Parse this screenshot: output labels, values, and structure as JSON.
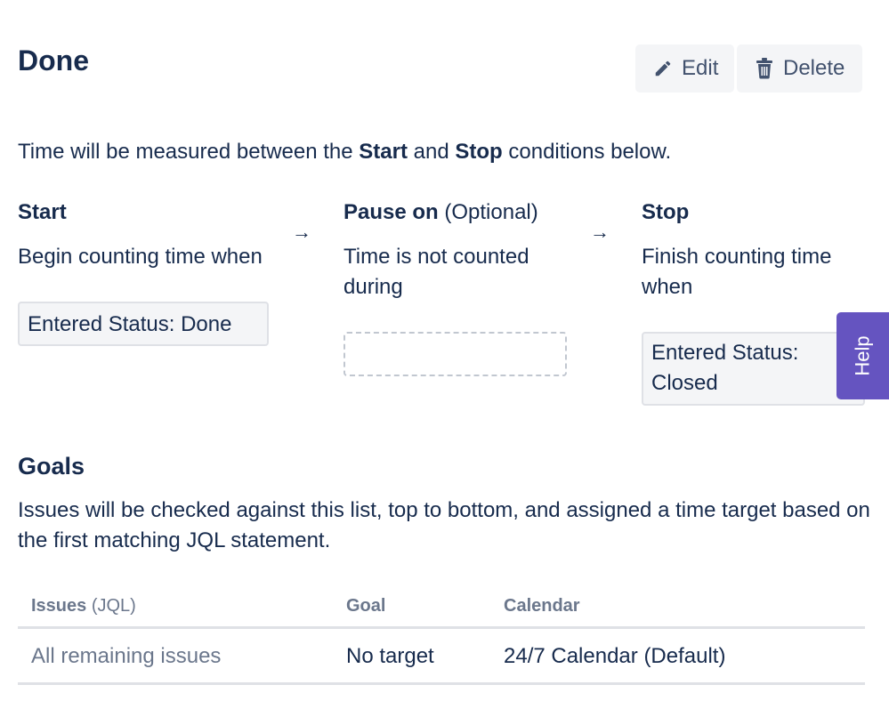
{
  "page": {
    "title": "Done"
  },
  "toolbar": {
    "edit_label": "Edit",
    "delete_label": "Delete",
    "edit_icon": "pencil-icon",
    "delete_icon": "trash-icon"
  },
  "intro": {
    "prefix": "Time will be measured between the ",
    "start_word": "Start",
    "middle": " and ",
    "stop_word": "Stop",
    "suffix": " conditions below."
  },
  "conditions": {
    "start": {
      "heading": "Start",
      "description": "Begin counting time when",
      "value": "Entered Status: Done"
    },
    "pause": {
      "heading": "Pause on",
      "optional": " (Optional)",
      "description": "Time is not counted during"
    },
    "stop": {
      "heading": "Stop",
      "description": "Finish counting time when",
      "value": "Entered Status: Closed"
    },
    "arrow": "→"
  },
  "help": {
    "label": "Help"
  },
  "goals": {
    "title": "Goals",
    "description": "Issues will be checked against this list, top to bottom, and assigned a time target based on the first matching JQL statement.",
    "columns": {
      "issues": "Issues",
      "issues_suffix": " (JQL)",
      "goal": "Goal",
      "calendar": "Calendar"
    },
    "rows": [
      {
        "issues": "All remaining issues",
        "goal": "No target",
        "calendar": "24/7 Calendar (Default)"
      }
    ]
  },
  "colors": {
    "text": "#172b4d",
    "muted": "#6b778c",
    "button_bg": "#f4f5f7",
    "help_bg": "#6554c0",
    "border": "#dfe1e6"
  }
}
